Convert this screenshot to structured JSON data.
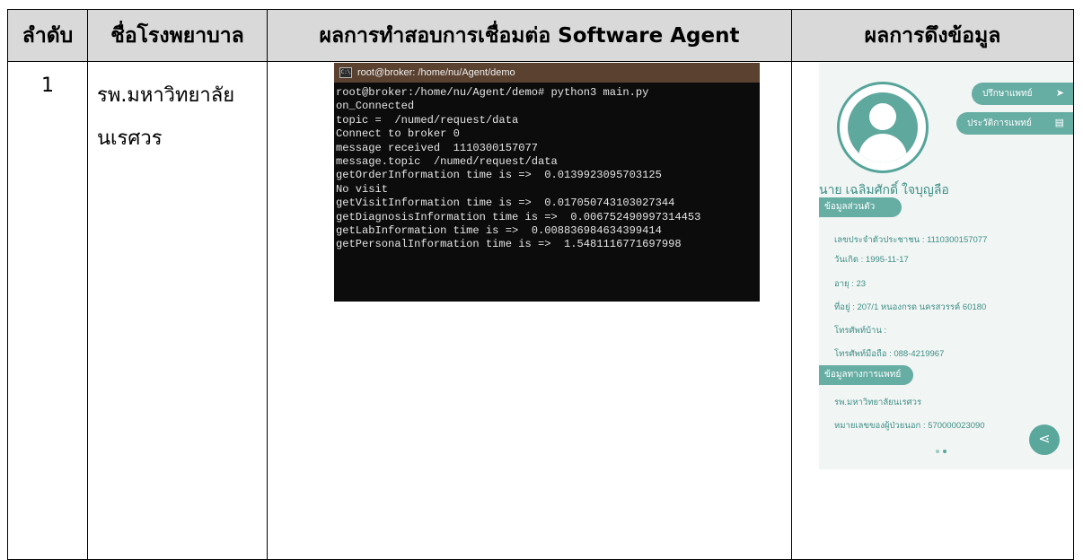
{
  "table": {
    "headers": [
      "ลำดับ",
      "ชื่อโรงพยาบาล",
      "ผลการทำสอบการเชื่อมต่อ Software Agent",
      "ผลการดึงข้อมูล"
    ],
    "row": {
      "number": "1",
      "hospital_line1": "รพ.มหาวิทยาลัย",
      "hospital_line2": "นเรศวร"
    }
  },
  "terminal": {
    "title": "root@broker: /home/nu/Agent/demo",
    "icon": "cmd-icon",
    "lines": [
      "root@broker:/home/nu/Agent/demo# python3 main.py",
      "on_Connected",
      "topic =  /numed/request/data",
      "Connect to broker 0",
      "message received  1110300157077",
      "message.topic  /numed/request/data",
      "getOrderInformation time is =>  0.0139923095703125",
      "No visit",
      "getVisitInformation time is =>  0.017050743103027344",
      "getDiagnosisInformation time is =>  0.006752490997314453",
      "getLabInformation time is =>  0.008836984634399414",
      "getPersonalInformation time is =>  1.5481116771697998"
    ]
  },
  "app": {
    "consult_button": "ปรึกษาแพทย์",
    "consult_icon": "send-icon",
    "history_button": "ประวัติการแพทย์",
    "history_icon": "id-card-icon",
    "patient_name": "นาย เฉลิมศักดิ์ ใจบุญลือ",
    "personal_section": "ข้อมูลส่วนตัว",
    "citizen_id": "เลขประจำตัวประชาชน : 1110300157077",
    "birthdate": "วันเกิด : 1995-11-17",
    "age": "อายุ : 23",
    "address": "ที่อยู่ : 207/1 หนองกรด นครสวรรค์ 60180",
    "home_phone": "โทรศัพท์บ้าน :",
    "mobile_phone": "โทรศัพท์มือถือ : 088-4219967",
    "medical_section": "ข้อมูลทางการแพทย์",
    "hospital": "รพ.มหาวิทยาลัยนเรศวร",
    "outpatient_no": "หมายเลขของผู้ป่วยนอก : 570000023090",
    "share_icon": "share-icon",
    "colors": {
      "accent": "#66ada3",
      "text": "#3f8f86"
    }
  }
}
